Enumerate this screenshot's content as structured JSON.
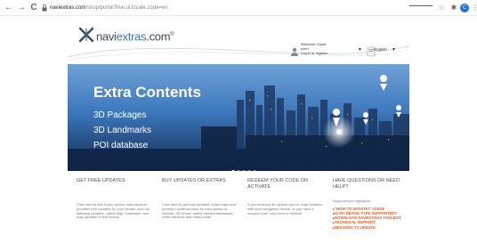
{
  "browser": {
    "back_glyph": "←",
    "forward_glyph": "→",
    "reload_glyph": "C",
    "lock_glyph": "🔒",
    "url_host": "naviextras.com",
    "url_path": "/shop/portal?live.ui.locale.code=en",
    "star_icon": "☆",
    "extension_icon": "✱",
    "profile_initial": "C",
    "menu_glyph": "⋮"
  },
  "header": {
    "logo_text_a": "navi",
    "logo_text_b": "extras",
    "logo_text_c": ".com",
    "logo_mark_symbol": "®",
    "account_line1": "Welcome Guest",
    "account_line2": "user!",
    "account_line3": "Log in or register",
    "language": "English",
    "caret": "▼"
  },
  "hero": {
    "title": "Extra Contents",
    "items": [
      "3D Packages",
      "3D Landmarks",
      "POI database"
    ],
    "slides": 5,
    "active_slide": 0
  },
  "columns": [
    {
      "heading": "GET FREE UPDATES",
      "body": "Click here to see if your device manufacturer provides free updates for your device, such as software updates, Latest Map Guarantee, free map updates or free extras."
    },
    {
      "heading": "BUY UPDATES OR EXTRAS",
      "body": "Click here to get map updates, extra maps and premium contents such as extra points of interest, 3D extras, safety camera databases, traffic services and many more!"
    },
    {
      "heading": "REDEEM YOUR CODE OR ACTIVATE",
      "body": "If you received an update card or code bundled with your navigation device, or you have a coupon code, click here to redeem."
    },
    {
      "heading": "HAVE QUESTIONS OR NEED HELP?",
      "body": "Support topic highlights:",
      "links": [
        "\"HOW TO UPDATE?\" GUIDE",
        "IS MY DEVICE TYPE SUPPORTED?",
        "DOWNLOAD NAVIEXTRAS TOOLBOX",
        "TECHNICAL SUPPORT",
        "REASONS TO UPDATE"
      ]
    }
  ],
  "colors": {
    "accent_orange": "#e45a24",
    "brand_blue": "#3a78b8",
    "hero_blue": "#2a64a8"
  }
}
